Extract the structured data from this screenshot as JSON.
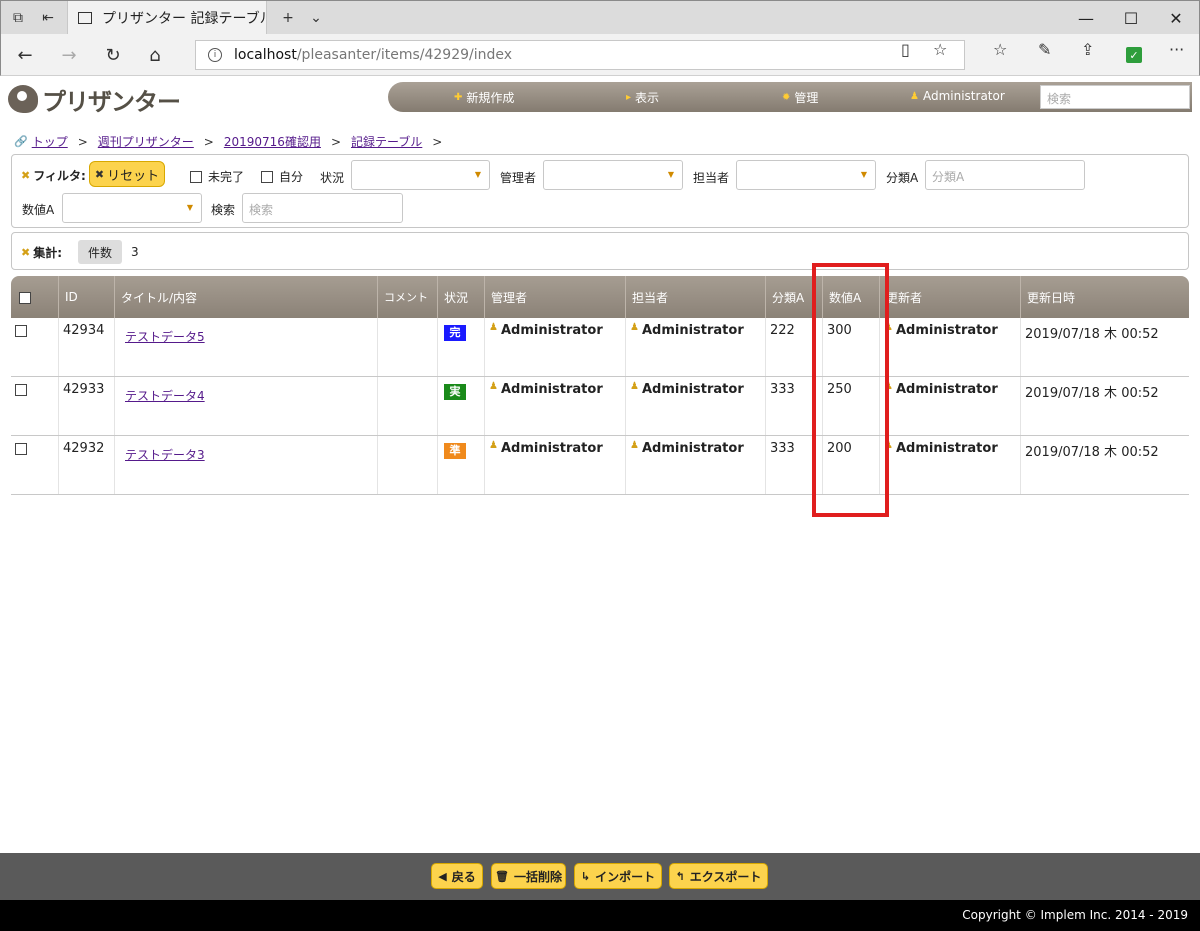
{
  "browser": {
    "tab_title": "プリザンター 記録テーブル :",
    "url_host": "localhost",
    "url_path": "/pleasanter/items/42929/index"
  },
  "app": {
    "logo_text": "プリザンター",
    "menu": {
      "new_label": "新規作成",
      "view_label": "表示",
      "manage_label": "管理",
      "user_label": "Administrator",
      "search_placeholder": "検索"
    }
  },
  "breadcrumb": [
    "トップ",
    "週刊プリザンター",
    "20190716確認用",
    "記録テーブル"
  ],
  "filters": {
    "title": "フィルタ:",
    "reset_label": "リセット",
    "incomplete_label": "未完了",
    "mine_label": "自分",
    "status_label": "状況",
    "manager_label": "管理者",
    "owner_label": "担当者",
    "classA_label": "分類A",
    "classA_placeholder": "分類A",
    "numA_label": "数値A",
    "search_label": "検索",
    "search_placeholder": "検索"
  },
  "aggregation": {
    "title": "集計:",
    "count_label": "件数",
    "count_value": "3"
  },
  "grid": {
    "columns": [
      "ID",
      "タイトル/内容",
      "コメント",
      "状況",
      "管理者",
      "担当者",
      "分類A",
      "数値A",
      "更新者",
      "更新日時"
    ],
    "rows": [
      {
        "id": "42934",
        "title": "テストデータ5",
        "status": "完",
        "status_color": "#1a1aff",
        "manager": "Administrator",
        "owner": "Administrator",
        "classA": "222",
        "numA": "300",
        "updater": "Administrator",
        "updated": "2019/07/18 木 00:52"
      },
      {
        "id": "42933",
        "title": "テストデータ4",
        "status": "実",
        "status_color": "#1a8a1a",
        "manager": "Administrator",
        "owner": "Administrator",
        "classA": "333",
        "numA": "250",
        "updater": "Administrator",
        "updated": "2019/07/18 木 00:52"
      },
      {
        "id": "42932",
        "title": "テストデータ3",
        "status": "準",
        "status_color": "#f08a1c",
        "manager": "Administrator",
        "owner": "Administrator",
        "classA": "333",
        "numA": "200",
        "updater": "Administrator",
        "updated": "2019/07/18 木 00:52"
      }
    ]
  },
  "footer": {
    "back_label": "戻る",
    "bulk_delete_label": "一括削除",
    "import_label": "インポート",
    "export_label": "エクスポート",
    "copyright": "Copyright © Implem Inc. 2014 - 2019"
  }
}
